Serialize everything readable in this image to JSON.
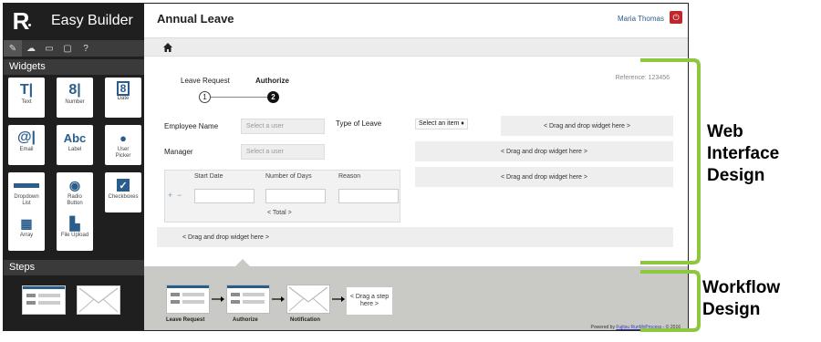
{
  "app": {
    "logo_letter": "R",
    "title": "Easy Builder"
  },
  "header": {
    "page_title": "Annual Leave",
    "user": "Maria Thomas"
  },
  "sidebar": {
    "widgets_title": "Widgets",
    "widgets": [
      {
        "label": "Text",
        "icon": "text-icon"
      },
      {
        "label": "Number",
        "icon": "number-icon"
      },
      {
        "label": "Date",
        "icon": "date-icon"
      },
      {
        "label": "Email",
        "icon": "email-icon"
      },
      {
        "label": "Label",
        "icon": "label-icon"
      },
      {
        "label": "User Picker",
        "icon": "user-picker-icon"
      },
      {
        "label": "Dropdown List",
        "icon": "dropdown-icon"
      },
      {
        "label": "Radio Button",
        "icon": "radio-icon"
      },
      {
        "label": "Checkboxes",
        "icon": "checkbox-icon"
      },
      {
        "label": "Array",
        "icon": "array-icon"
      },
      {
        "label": "File Upload",
        "icon": "file-upload-icon"
      }
    ],
    "steps_title": "Steps"
  },
  "form": {
    "steps": [
      {
        "label": "Leave Request",
        "number": "1"
      },
      {
        "label": "Authorize",
        "number": "2"
      }
    ],
    "reference": "Reference: 123456",
    "employee_label": "Employee Name",
    "employee_placeholder": "Select a user",
    "manager_label": "Manager",
    "manager_placeholder": "Select a user",
    "leave_type_label": "Type of Leave",
    "leave_type_value": "Select an item ♦",
    "drop_here": "< Drag and drop widget here >",
    "table": {
      "headers": [
        "Start Date",
        "Number of Days",
        "Reason"
      ],
      "total": "< Total >"
    }
  },
  "workflow": {
    "steps": [
      "Leave Request",
      "Authorize",
      "Notification"
    ],
    "drag_step": "< Drag a step here >",
    "powered_prefix": "Powered by ",
    "powered_link": "Fujitsu RunMyProcess",
    "powered_suffix": " - © 2016"
  },
  "annotations": {
    "web": [
      "Web",
      "Interface",
      "Design"
    ],
    "workflow": [
      "Workflow",
      "Design"
    ]
  },
  "colors": {
    "bracket": "#8dc63f",
    "accent": "#2a5d8c",
    "power": "#c0272d"
  }
}
